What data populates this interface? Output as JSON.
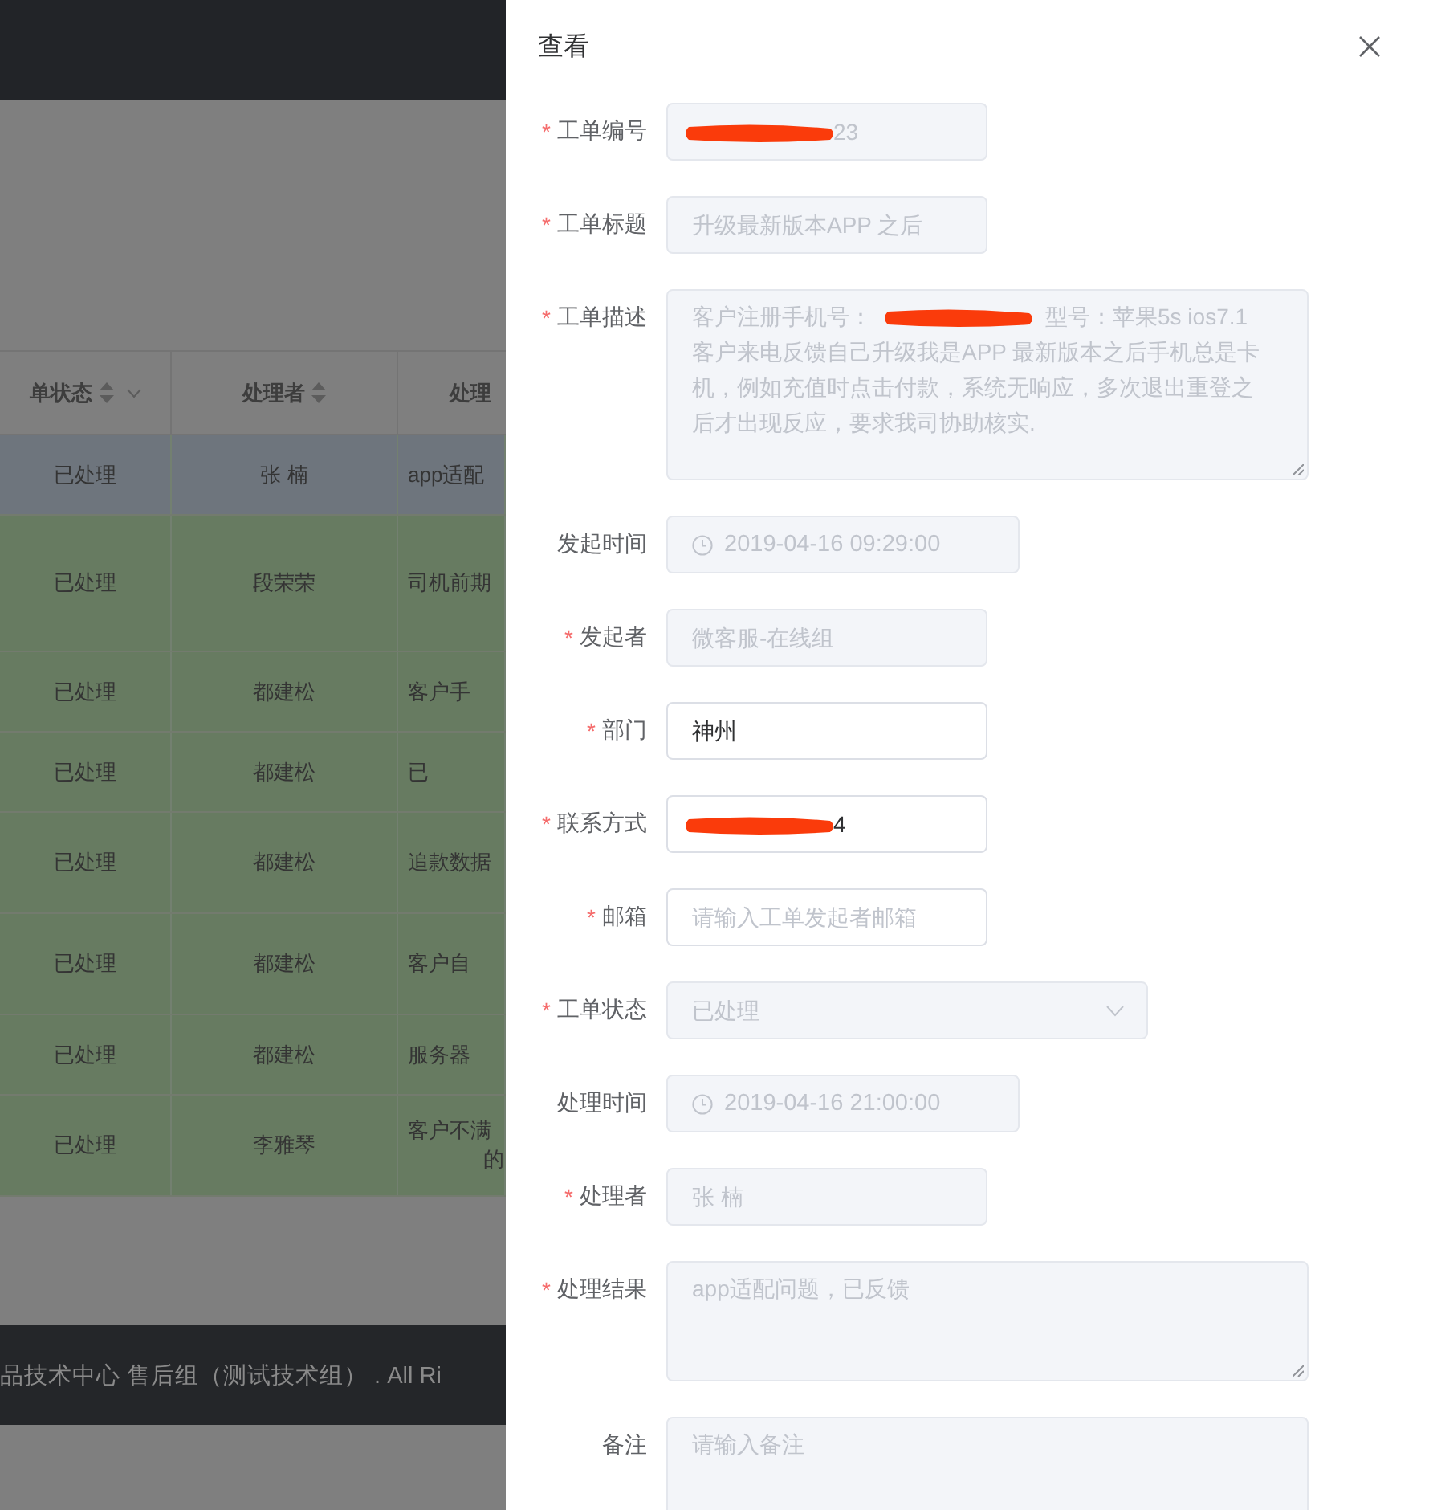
{
  "background_table": {
    "columns": [
      {
        "label": "单状态",
        "sortable": true,
        "filterable": true
      },
      {
        "label": "处理者",
        "sortable": true,
        "filterable": false
      },
      {
        "label": "处理"
      }
    ],
    "rows": [
      {
        "selected": true,
        "cells": [
          "已处理",
          "张 楠",
          "app适配"
        ]
      },
      {
        "selected": false,
        "cells": [
          "已处理",
          "段荣荣",
          "司机前期"
        ]
      },
      {
        "selected": false,
        "cells": [
          "已处理",
          "都建松",
          "客户手"
        ]
      },
      {
        "selected": false,
        "cells": [
          "已处理",
          "都建松",
          "已"
        ]
      },
      {
        "selected": false,
        "cells": [
          "已处理",
          "都建松",
          "追款数据"
        ]
      },
      {
        "selected": false,
        "cells": [
          "已处理",
          "都建松",
          "客户自"
        ]
      },
      {
        "selected": false,
        "cells": [
          "已处理",
          "都建松",
          "服务器"
        ]
      },
      {
        "selected": false,
        "cells": [
          "已处理",
          "李雅琴",
          "客户不满",
          "的"
        ]
      }
    ]
  },
  "footer": "品技术中心 售后组（测试技术组） . All Ri",
  "drawer": {
    "title": "查看",
    "required_mark": "*",
    "fields": [
      {
        "label": "工单编号",
        "required": true,
        "kind": "text",
        "disabled": true,
        "value_parts": [
          {
            "kind": "redaction"
          },
          {
            "kind": "text",
            "text": "23"
          }
        ]
      },
      {
        "label": "工单标题",
        "required": true,
        "kind": "text",
        "disabled": true,
        "value": "升级最新版本APP 之后"
      },
      {
        "label": "工单描述",
        "required": true,
        "kind": "textarea",
        "disabled": true,
        "value_parts": [
          {
            "kind": "text",
            "text": "客户注册手机号："
          },
          {
            "kind": "redaction"
          },
          {
            "kind": "text",
            "text": "型号：苹果5s ios7.1"
          },
          {
            "kind": "break"
          },
          {
            "kind": "text",
            "text": "客户来电反馈自己升级我是APP 最新版本之后手机总是卡机，例如充值时点击付款，系统无响应，多次退出重登之后才出现反应，要求我司协助核实."
          }
        ]
      },
      {
        "label": "发起时间",
        "required": false,
        "kind": "date",
        "disabled": true,
        "value": "2019-04-16 09:29:00"
      },
      {
        "label": "发起者",
        "required": true,
        "kind": "text",
        "disabled": true,
        "value": "微客服-在线组"
      },
      {
        "label": "部门",
        "required": true,
        "kind": "text",
        "disabled": false,
        "value": "神州"
      },
      {
        "label": "联系方式",
        "required": true,
        "kind": "text",
        "disabled": false,
        "value_parts": [
          {
            "kind": "redaction"
          },
          {
            "kind": "text",
            "text": "4"
          }
        ]
      },
      {
        "label": "邮箱",
        "required": true,
        "kind": "text",
        "disabled": false,
        "placeholder": "请输入工单发起者邮箱"
      },
      {
        "label": "工单状态",
        "required": true,
        "kind": "select",
        "disabled": true,
        "value": "已处理"
      },
      {
        "label": "处理时间",
        "required": false,
        "kind": "date",
        "disabled": true,
        "value": "2019-04-16 21:00:00"
      },
      {
        "label": "处理者",
        "required": true,
        "kind": "text",
        "disabled": true,
        "value": "张 楠"
      },
      {
        "label": "处理结果",
        "required": true,
        "kind": "textarea",
        "disabled": true,
        "value": "app适配问题，已反馈"
      },
      {
        "label": "备注",
        "required": false,
        "kind": "textarea",
        "disabled": true,
        "placeholder": "请输入备注"
      }
    ]
  }
}
